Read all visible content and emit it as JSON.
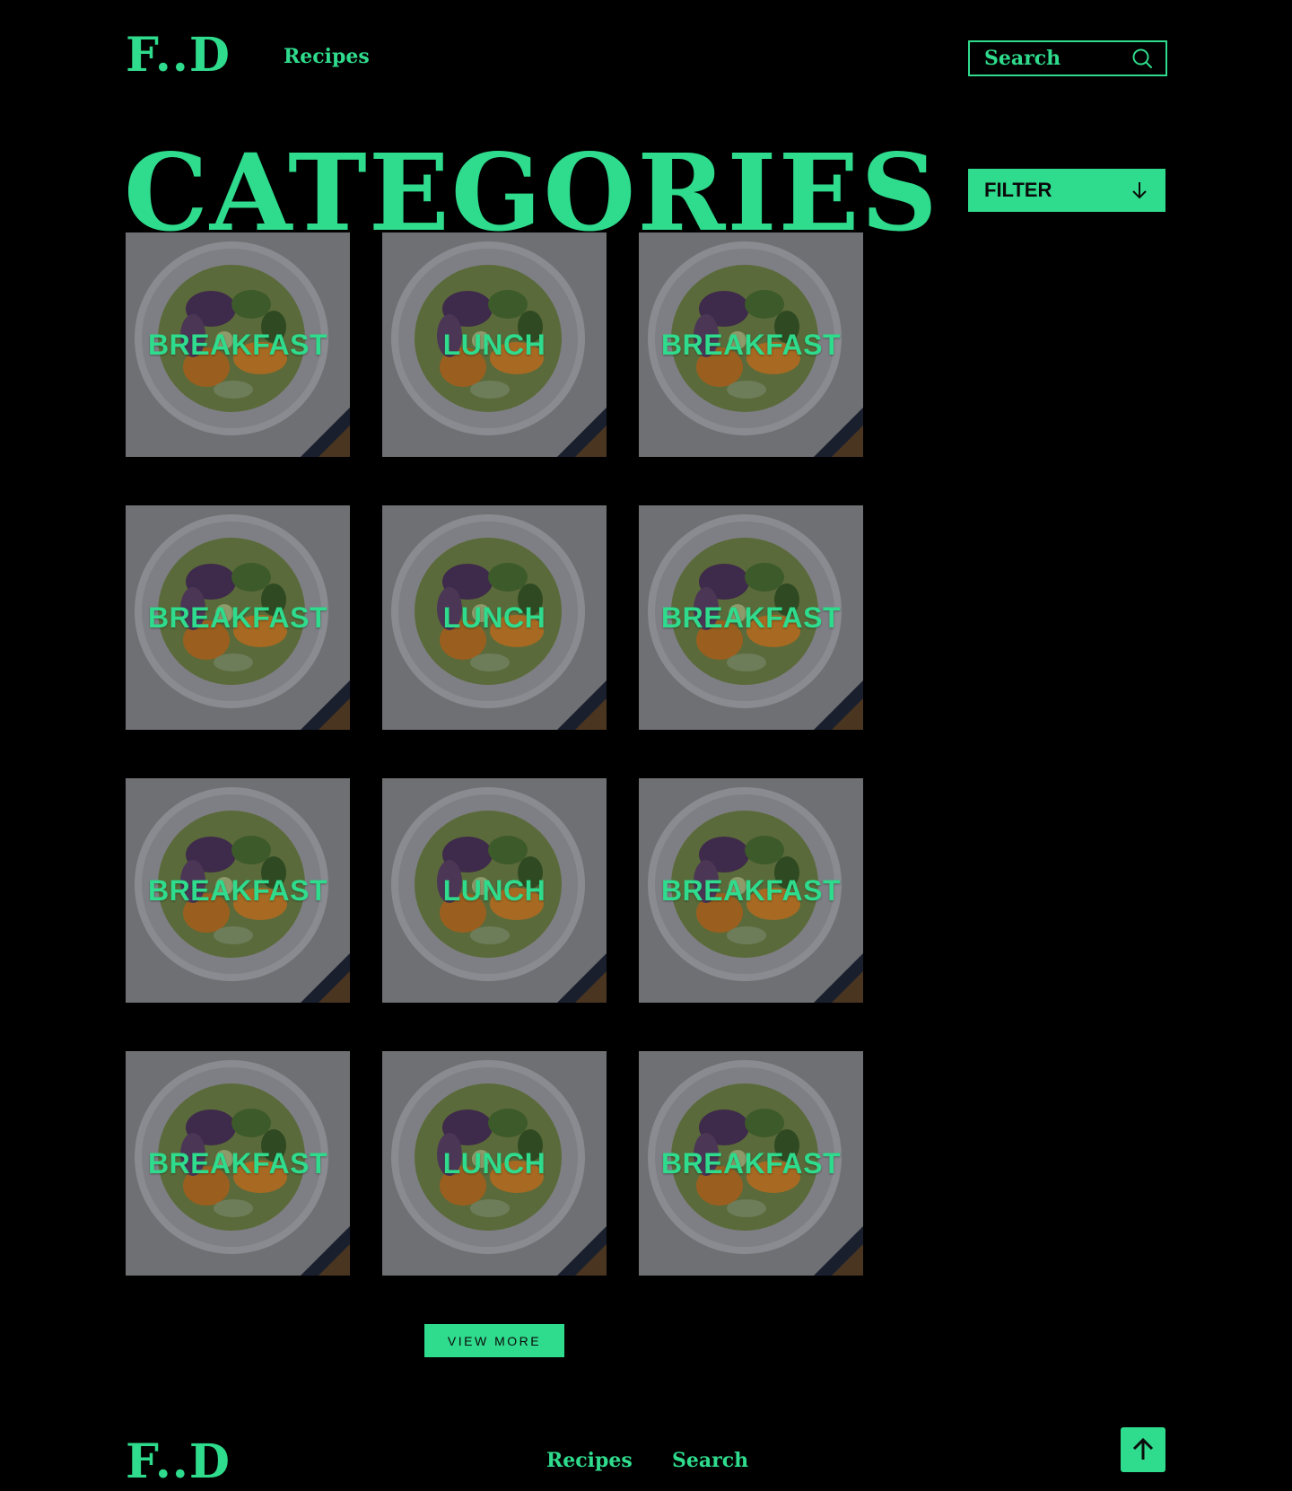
{
  "colors": {
    "accent": "#2fdb8c",
    "background": "#000000",
    "card_overlay": "#6e6e72"
  },
  "header": {
    "logo": "F..D",
    "nav": {
      "recipes": "Recipes"
    },
    "search": {
      "placeholder": "Search",
      "icon": "search-icon"
    }
  },
  "main": {
    "title": "CATEGORIES",
    "filter": {
      "label": "FILTER",
      "icon": "arrow-down-icon"
    },
    "categories": [
      "BREAKFAST",
      "LUNCH",
      "BREAKFAST",
      "BREAKFAST",
      "LUNCH",
      "BREAKFAST",
      "BREAKFAST",
      "LUNCH",
      "BREAKFAST",
      "BREAKFAST",
      "LUNCH",
      "BREAKFAST"
    ],
    "view_more": "VIEW MORE"
  },
  "footer": {
    "logo": "F..D",
    "nav": {
      "recipes": "Recipes",
      "search": "Search"
    },
    "scroll_top_icon": "arrow-up-icon"
  }
}
